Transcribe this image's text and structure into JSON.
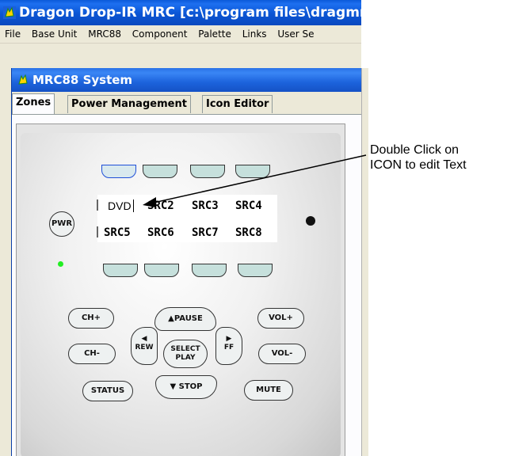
{
  "window": {
    "title": "Dragon Drop-IR MRC [c:\\program files\\dragmrc\\p",
    "icon": "dragon-app-icon"
  },
  "menu": [
    "File",
    "Base Unit",
    "MRC88",
    "Component",
    "Palette",
    "Links",
    "User Se"
  ],
  "child_window": {
    "title": "MRC88 System",
    "icon": "dragon-app-icon"
  },
  "tabs": [
    {
      "label": "Zones",
      "active": true
    },
    {
      "label": "Power Management",
      "active": false
    },
    {
      "label": "Icon Editor",
      "active": false
    }
  ],
  "remote": {
    "display": {
      "row1": [
        "DVD",
        "SRC2",
        "SRC3",
        "SRC4"
      ],
      "row2": [
        "SRC5",
        "SRC6",
        "SRC7",
        "SRC8"
      ],
      "editing_index": 0
    },
    "buttons": {
      "pwr": "PWR",
      "ch_up": "CH+",
      "ch_down": "CH-",
      "pause": "▲PAUSE",
      "rew_arrow": "◀",
      "rew": "REW",
      "select": "SELECT",
      "play": "PLAY",
      "ff_arrow": "▶",
      "ff": "FF",
      "stop": "▼ STOP",
      "vol_up": "VOL+",
      "vol_down": "VOL-",
      "status": "STATUS",
      "mute": "MUTE"
    },
    "colors": {
      "source_key": "#c6e0dc",
      "selected_key_border": "#1f4fd8",
      "power_led": "#22ee22"
    }
  },
  "annotation": {
    "line1": "Double Click on",
    "line2": "ICON to edit Text"
  }
}
